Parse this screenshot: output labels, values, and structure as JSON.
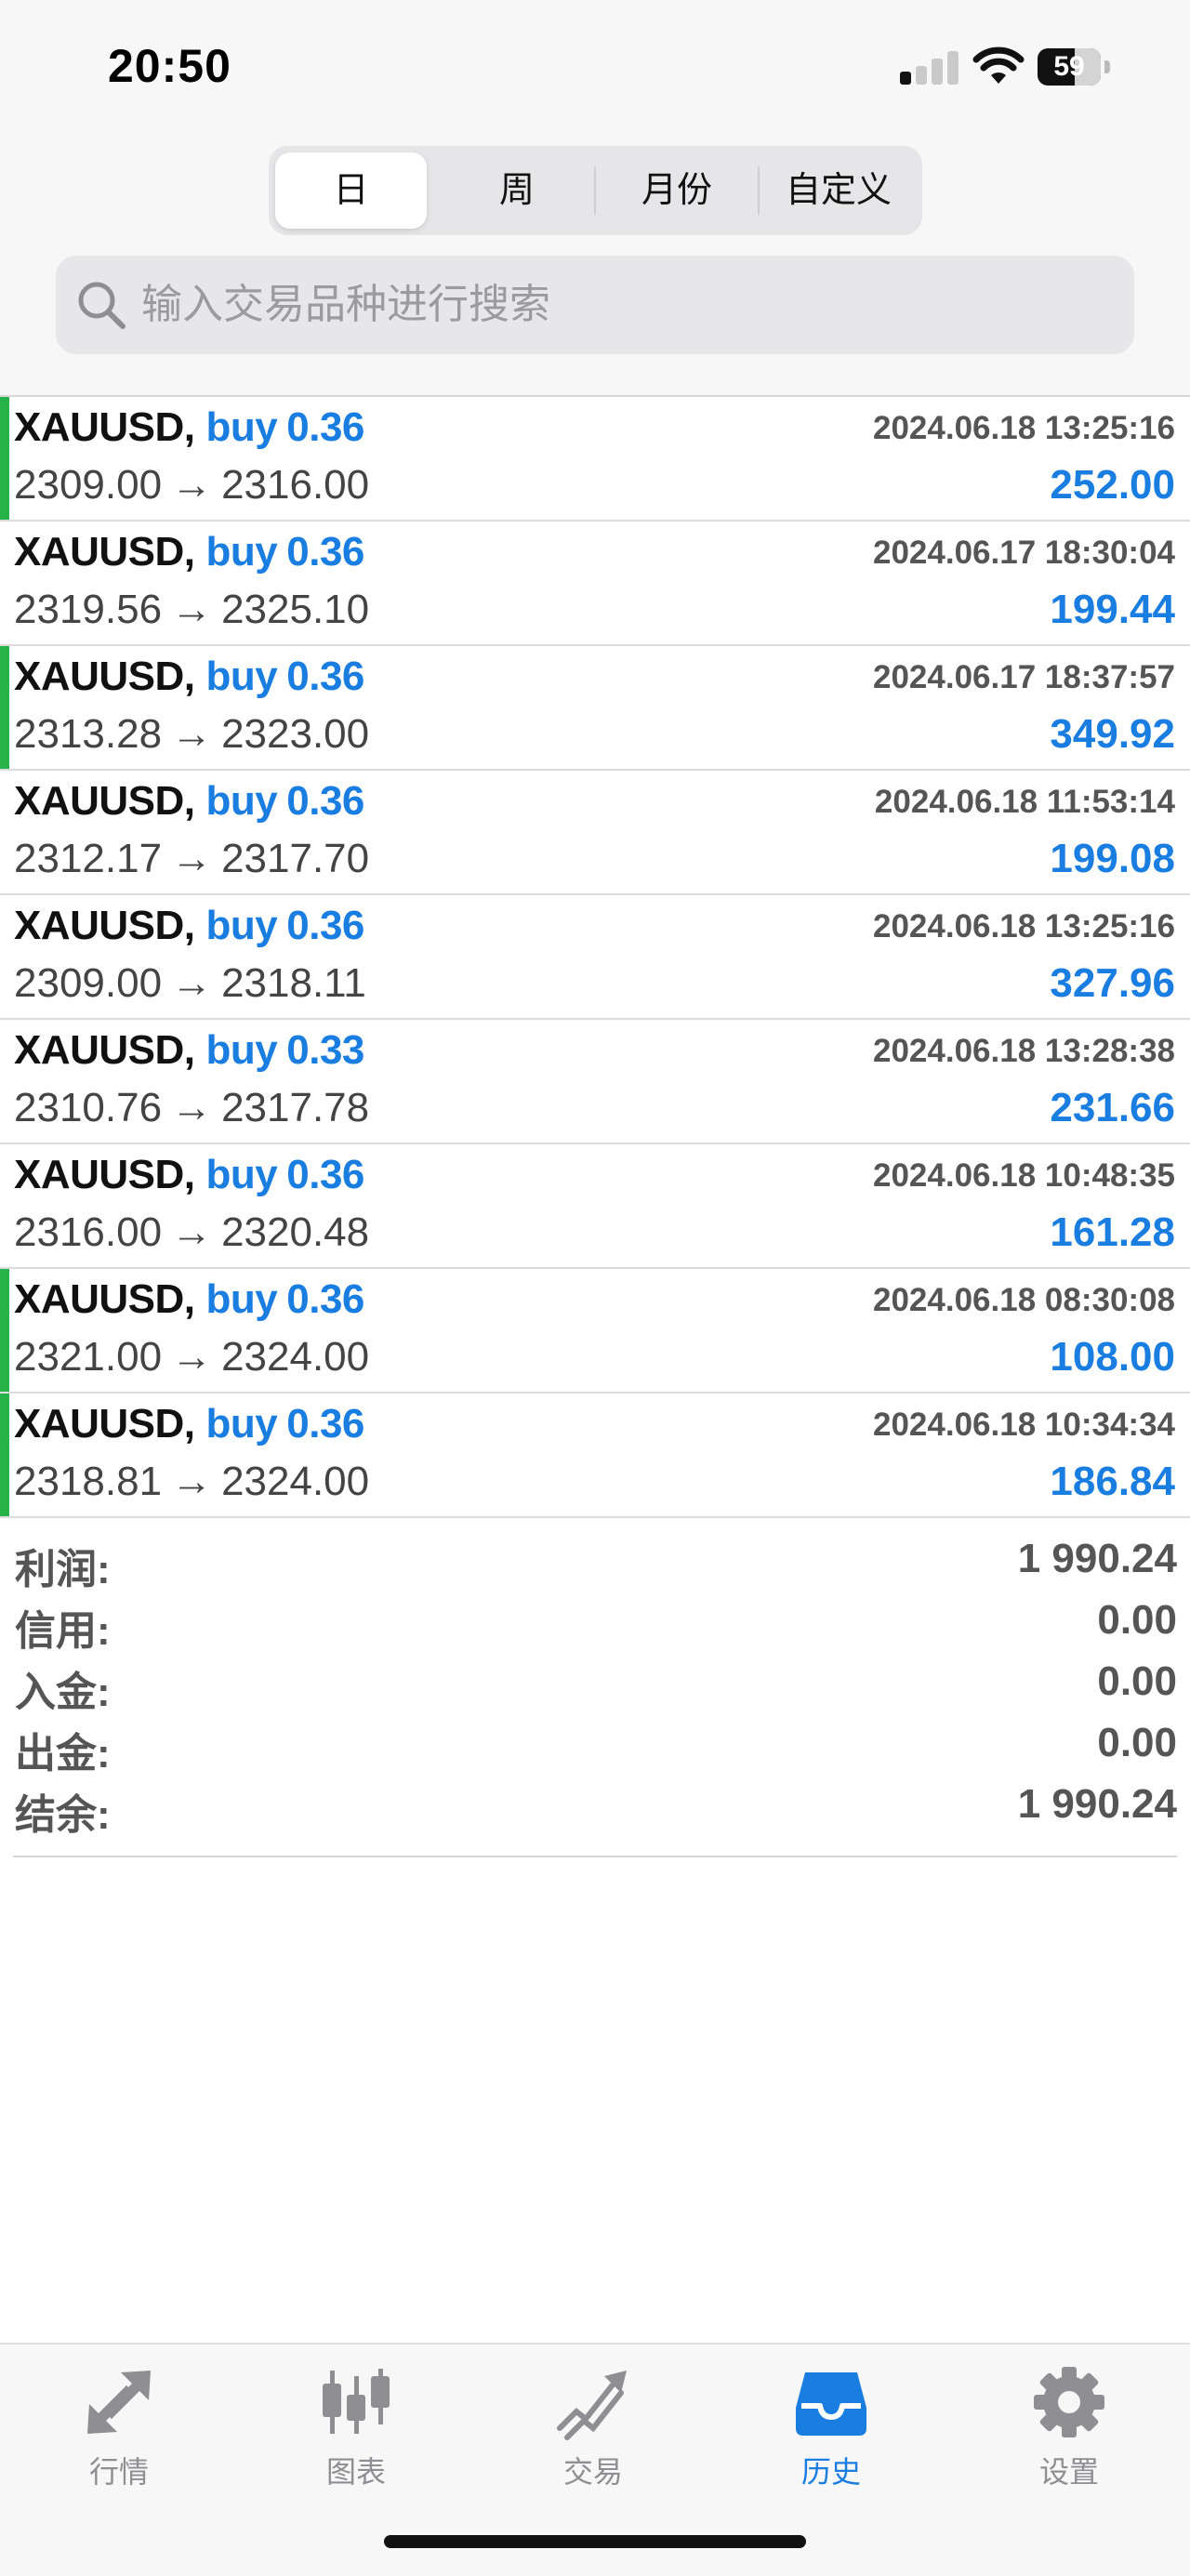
{
  "status_bar": {
    "time": "20:50",
    "battery": "59"
  },
  "segments": [
    "日",
    "周",
    "月份",
    "自定义"
  ],
  "active_segment": 0,
  "search": {
    "placeholder": "输入交易品种进行搜索"
  },
  "trades": [
    {
      "symbol": "XAUUSD,",
      "side": "buy",
      "lot": "0.36",
      "datetime": "2024.06.18 13:25:16",
      "open": "2309.00",
      "arrow": "→",
      "close": "2316.00",
      "profit": "252.00",
      "indicator": true
    },
    {
      "symbol": "XAUUSD,",
      "side": "buy",
      "lot": "0.36",
      "datetime": "2024.06.17 18:30:04",
      "open": "2319.56",
      "arrow": "→",
      "close": "2325.10",
      "profit": "199.44",
      "indicator": false
    },
    {
      "symbol": "XAUUSD,",
      "side": "buy",
      "lot": "0.36",
      "datetime": "2024.06.17 18:37:57",
      "open": "2313.28",
      "arrow": "→",
      "close": "2323.00",
      "profit": "349.92",
      "indicator": true
    },
    {
      "symbol": "XAUUSD,",
      "side": "buy",
      "lot": "0.36",
      "datetime": "2024.06.18 11:53:14",
      "open": "2312.17",
      "arrow": "→",
      "close": "2317.70",
      "profit": "199.08",
      "indicator": false
    },
    {
      "symbol": "XAUUSD,",
      "side": "buy",
      "lot": "0.36",
      "datetime": "2024.06.18 13:25:16",
      "open": "2309.00",
      "arrow": "→",
      "close": "2318.11",
      "profit": "327.96",
      "indicator": false
    },
    {
      "symbol": "XAUUSD,",
      "side": "buy",
      "lot": "0.33",
      "datetime": "2024.06.18 13:28:38",
      "open": "2310.76",
      "arrow": "→",
      "close": "2317.78",
      "profit": "231.66",
      "indicator": false
    },
    {
      "symbol": "XAUUSD,",
      "side": "buy",
      "lot": "0.36",
      "datetime": "2024.06.18 10:48:35",
      "open": "2316.00",
      "arrow": "→",
      "close": "2320.48",
      "profit": "161.28",
      "indicator": false
    },
    {
      "symbol": "XAUUSD,",
      "side": "buy",
      "lot": "0.36",
      "datetime": "2024.06.18 08:30:08",
      "open": "2321.00",
      "arrow": "→",
      "close": "2324.00",
      "profit": "108.00",
      "indicator": true
    },
    {
      "symbol": "XAUUSD,",
      "side": "buy",
      "lot": "0.36",
      "datetime": "2024.06.18 10:34:34",
      "open": "2318.81",
      "arrow": "→",
      "close": "2324.00",
      "profit": "186.84",
      "indicator": true
    }
  ],
  "summary": [
    {
      "label": "利润:",
      "value": "1 990.24"
    },
    {
      "label": "信用:",
      "value": "0.00"
    },
    {
      "label": "入金:",
      "value": "0.00"
    },
    {
      "label": "出金:",
      "value": "0.00"
    },
    {
      "label": "结余:",
      "value": "1 990.24"
    }
  ],
  "tabs": [
    {
      "label": "行情",
      "icon": "quotes-icon"
    },
    {
      "label": "图表",
      "icon": "chart-icon"
    },
    {
      "label": "交易",
      "icon": "trade-icon"
    },
    {
      "label": "历史",
      "icon": "history-icon"
    },
    {
      "label": "设置",
      "icon": "settings-icon"
    }
  ],
  "active_tab": 3,
  "colors": {
    "accent": "#1a7de0",
    "indicator": "#27b24a",
    "tab_inactive": "#8e8e93"
  }
}
